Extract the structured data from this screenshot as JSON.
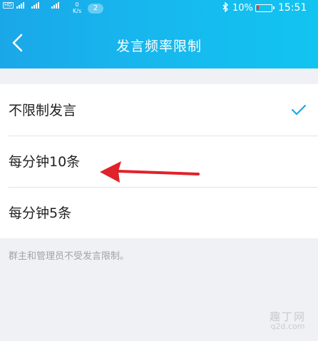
{
  "status_bar": {
    "network_speed": "0",
    "network_unit": "K/s",
    "notification_count": "2",
    "battery": "10%",
    "time": "15:51"
  },
  "nav": {
    "title": "发言频率限制"
  },
  "options": [
    {
      "label": "不限制发言",
      "selected": true
    },
    {
      "label": "每分钟10条",
      "selected": false
    },
    {
      "label": "每分钟5条",
      "selected": false
    }
  ],
  "hint": "群主和管理员不受发言限制。",
  "watermark": {
    "line1": "趣丁网",
    "line2": "q2d.com"
  },
  "colors": {
    "accent": "#1aa7e8",
    "check": "#1aa7e8",
    "arrow": "#e0222b"
  }
}
